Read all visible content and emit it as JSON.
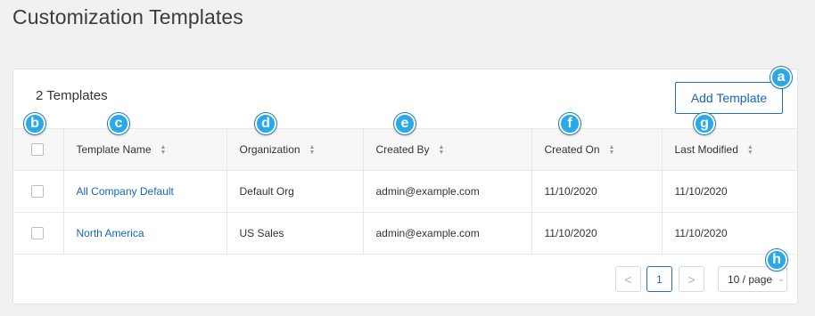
{
  "page": {
    "title": "Customization Templates"
  },
  "toolbar": {
    "count_label": "2 Templates",
    "add_label": "Add Template"
  },
  "table": {
    "columns": [
      "Template Name",
      "Organization",
      "Created By",
      "Created On",
      "Last Modified"
    ],
    "rows": [
      {
        "name": "All Company Default",
        "organization": "Default Org",
        "created_by": "admin@example.com",
        "created_on": "11/10/2020",
        "last_modified": "11/10/2020"
      },
      {
        "name": "North America",
        "organization": "US Sales",
        "created_by": "admin@example.com",
        "created_on": "11/10/2020",
        "last_modified": "11/10/2020"
      }
    ]
  },
  "pagination": {
    "prev": "<",
    "current": "1",
    "next": ">",
    "page_size": "10 / page"
  },
  "markers": [
    "a",
    "b",
    "c",
    "d",
    "e",
    "f",
    "g",
    "h"
  ],
  "colors": {
    "accent": "#1565c0",
    "marker": "#2aa8e8",
    "background": "#f1f1f1"
  }
}
